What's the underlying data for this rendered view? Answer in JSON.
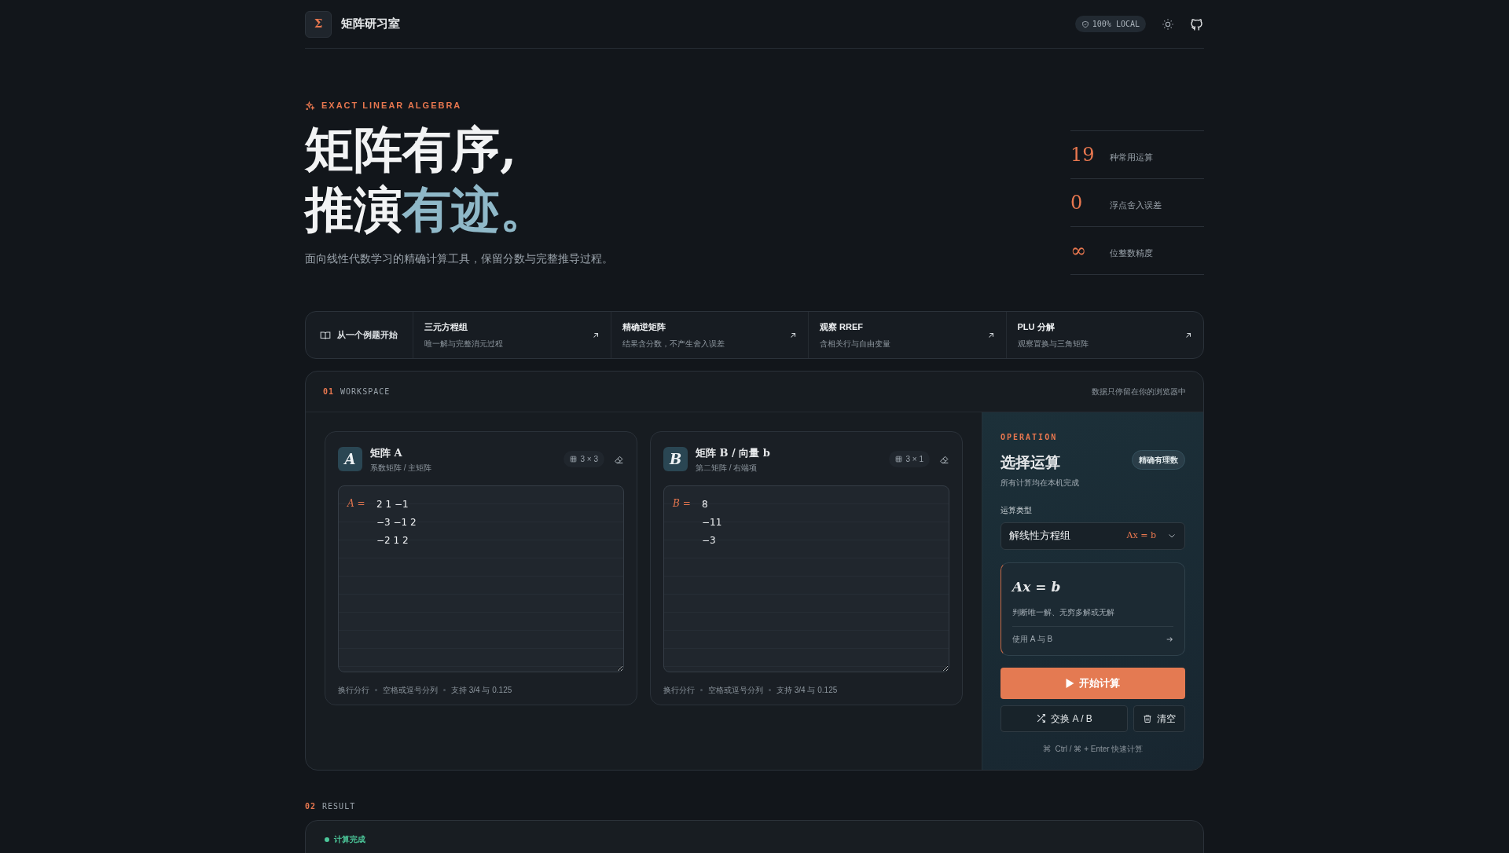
{
  "header": {
    "logo_glyph": "Σ",
    "title": "矩阵研习室",
    "badge": "100% LOCAL"
  },
  "hero": {
    "eyebrow": "EXACT LINEAR ALGEBRA",
    "line1": "矩阵有序,",
    "line2_plain": "推演",
    "line2_accent": "有迹",
    "line2_end": "。",
    "subtitle": "面向线性代数学习的精确计算工具，保留分数与完整推导过程。",
    "stats": [
      {
        "value": "19",
        "label": "种常用运算"
      },
      {
        "value": "0",
        "label": "浮点舍入误差"
      },
      {
        "value": "∞",
        "label": "位整数精度"
      }
    ]
  },
  "examples": {
    "intro": "从一个例题开始",
    "items": [
      {
        "title": "三元方程组",
        "desc": "唯一解与完整消元过程"
      },
      {
        "title": "精确逆矩阵",
        "desc": "结果含分数，不产生舍入误差"
      },
      {
        "title": "观察 RREF",
        "desc": "含相关行与自由变量"
      },
      {
        "title": "PLU 分解",
        "desc": "观察置换与三角矩阵"
      }
    ]
  },
  "workspace": {
    "number": "01",
    "label": "WORKSPACE",
    "note": "数据只停留在你的浏览器中",
    "matrices": [
      {
        "letter": "A",
        "title": "矩阵 A",
        "subtitle": "系数矩阵 / 主矩阵",
        "size": "3 × 3",
        "var": "A =",
        "rows": [
          "2 1 −1",
          "−3 −1 2",
          "−2 1 2"
        ],
        "hint": [
          "换行分行",
          "空格或逗号分列",
          "支持 3/4 与 0.125"
        ]
      },
      {
        "letter": "B",
        "title": "矩阵 B / 向量 b",
        "subtitle": "第二矩阵 / 右端项",
        "size": "3 × 1",
        "var": "B =",
        "rows": [
          "8",
          "−11",
          "−3"
        ],
        "hint": [
          "换行分行",
          "空格或逗号分列",
          "支持 3/4 与 0.125"
        ]
      }
    ]
  },
  "operation": {
    "eyebrow": "OPERATION",
    "title": "选择运算",
    "badge": "精确有理数",
    "subtitle": "所有计算均在本机完成",
    "type_label": "运算类型",
    "selected_op": "解线性方程组",
    "selected_formula": "Ax = b",
    "card": {
      "formula": "Ax = b",
      "desc": "判断唯一解、无穷多解或无解",
      "uses": "使用 A 与 B"
    },
    "run": "开始计算",
    "swap": "交换 A / B",
    "clear": "清空",
    "shortcut": "Ctrl / ⌘ + Enter 快速计算"
  },
  "result": {
    "number": "02",
    "label": "RESULT",
    "status": "计算完成"
  }
}
